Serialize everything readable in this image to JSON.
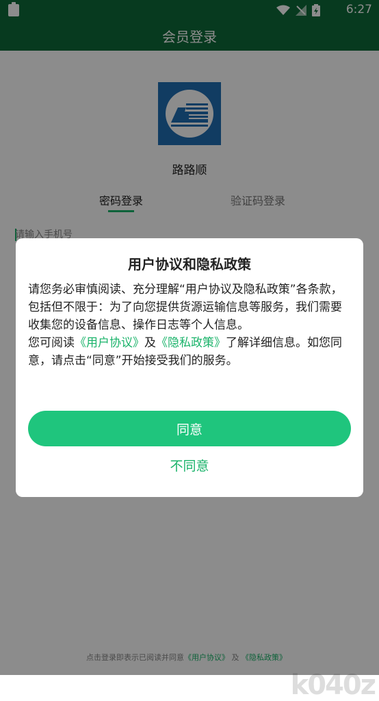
{
  "status_bar": {
    "time": "6:27"
  },
  "header": {
    "title": "会员登录"
  },
  "app": {
    "name": "路路顺"
  },
  "tabs": [
    {
      "label": "密码登录",
      "active": true
    },
    {
      "label": "验证码登录",
      "active": false
    }
  ],
  "form": {
    "phone_placeholder": "请输入手机号"
  },
  "footer": {
    "prefix": "点击登录即表示已阅读并同意",
    "link1": "《用户协议》",
    "and": "及",
    "link2": "《隐私政策》"
  },
  "dialog": {
    "title": "用户协议和隐私政策",
    "body_part1": "请您务必审慎阅读、充分理解“用户协议及隐私政策”各条款，包括但不限于：为了向您提供货源运输信息等服务，我们需要收集您的设备信息、操作日志等个人信息。",
    "body_part2_prefix": "您可阅读",
    "link_user_agreement": "《用户协议》",
    "and": "及",
    "link_privacy_policy": "《隐私政策》",
    "body_part2_suffix": "了解详细信息。如您同意，请点击“同意”开始接受我们的服务。",
    "agree_label": "同意",
    "disagree_label": "不同意"
  },
  "watermark": {
    "text": "k040z"
  },
  "colors": {
    "primary_dark": "#0e6b3a",
    "accent": "#1ab36a",
    "button": "#1fc57d",
    "logo_blue": "#1f6db2"
  }
}
